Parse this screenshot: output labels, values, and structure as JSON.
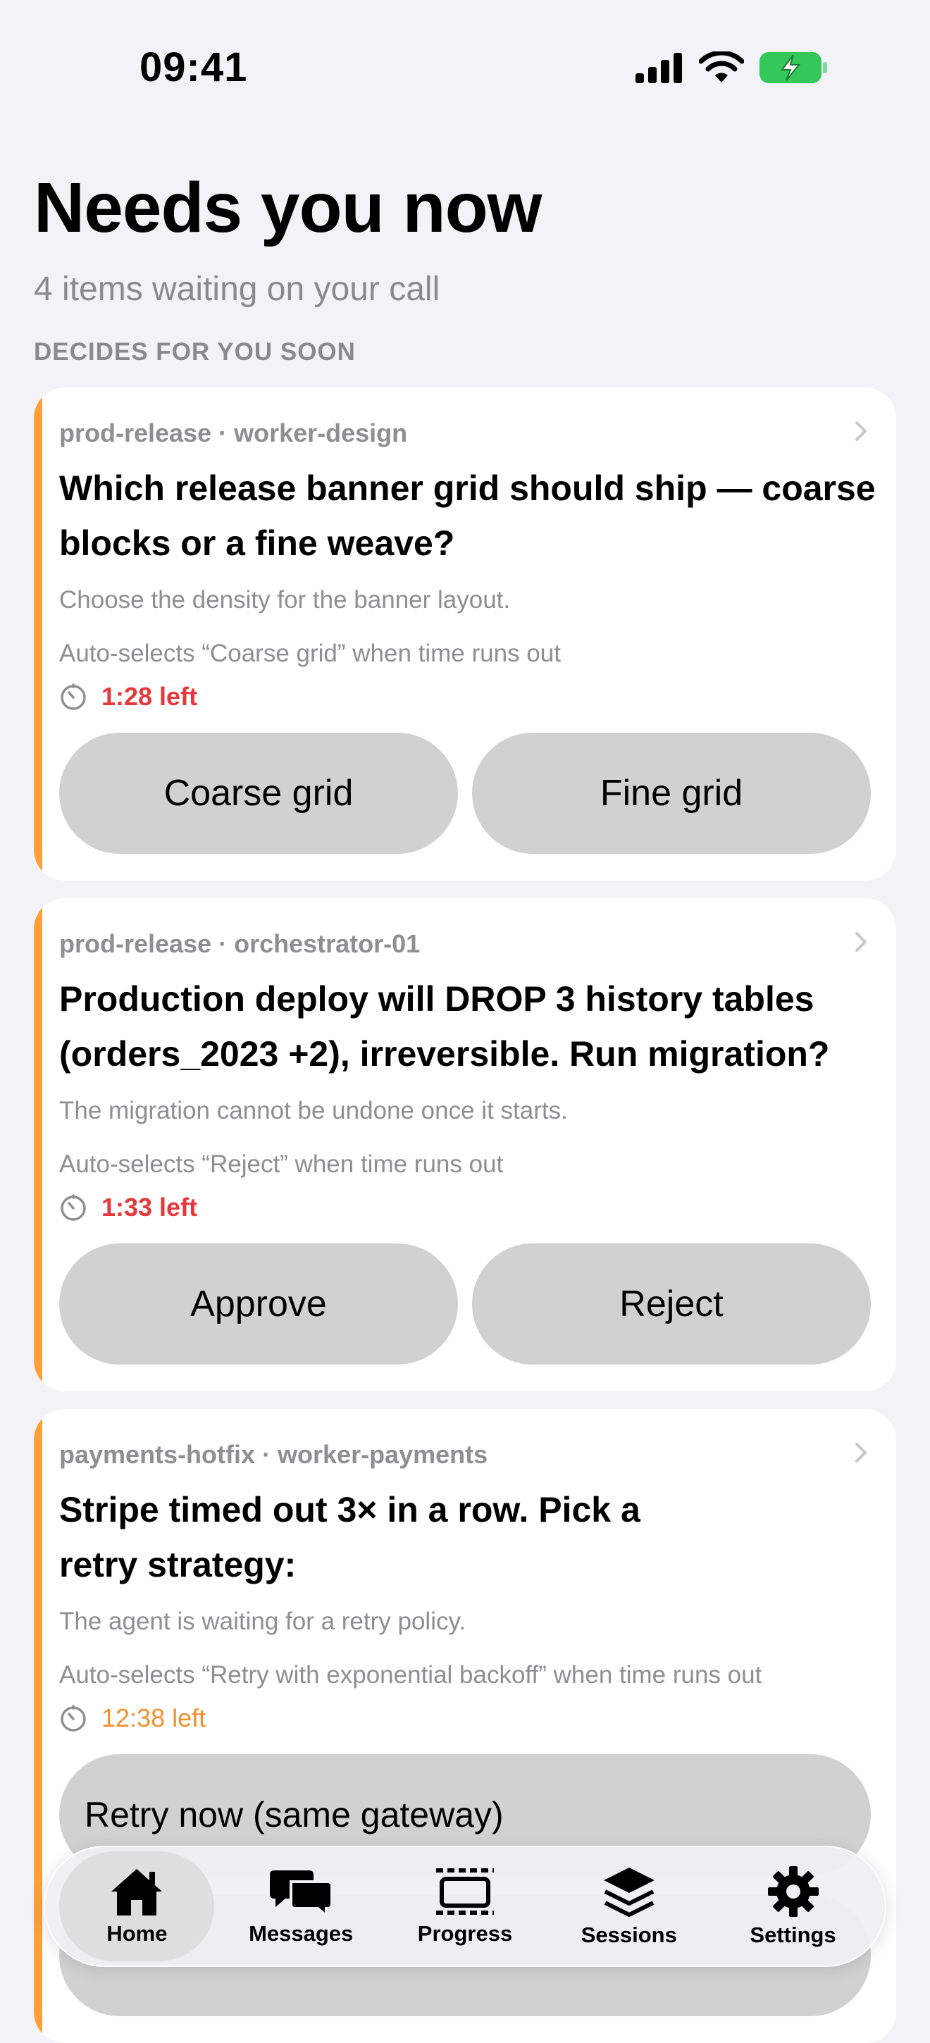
{
  "status_bar": {
    "time": "09:41",
    "icons": [
      "cellular-signal-icon",
      "wifi-icon",
      "battery-charging-icon"
    ],
    "battery_color": "#34C759"
  },
  "header": {
    "title": "Needs you now",
    "subtitle": "4 items waiting on your call"
  },
  "section_label": "DECIDES FOR YOU SOON",
  "accent_color": "#FF9F3A",
  "cards": [
    {
      "meta": "prod-release · worker-design",
      "title": "Which release banner grid should ship — coarse blocks or a fine weave?",
      "description": "Choose the density for the banner layout.",
      "auto_select": "Auto-selects “Coarse grid” when time runs out",
      "time_left": "1:28 left",
      "timer_color": "#E5383B",
      "options": [
        "Coarse grid",
        "Fine grid"
      ]
    },
    {
      "meta": "prod-release · orchestrator-01",
      "title": "Production deploy will DROP 3 history tables (orders_2023 +2), irreversible. Run migration?",
      "description": "The migration cannot be undone once it starts.",
      "auto_select": "Auto-selects “Reject” when time runs out",
      "time_left": "1:33 left",
      "timer_color": "#E5383B",
      "options": [
        "Approve",
        "Reject"
      ]
    },
    {
      "meta": "payments-hotfix · worker-payments",
      "title_line1": "Stripe timed out 3× in a row. Pick a",
      "title_line2": "retry strategy:",
      "description": "The agent is waiting for a retry policy.",
      "auto_select": "Auto-selects “Retry with exponential backoff” when time runs out",
      "time_left": "12:38 left",
      "timer_color": "#F0912E",
      "options": [
        "Retry now (same gateway)"
      ]
    }
  ],
  "tabbar": {
    "active": "Home",
    "tabs": [
      {
        "label": "Home",
        "icon": "home-icon"
      },
      {
        "label": "Messages",
        "icon": "messages-icon"
      },
      {
        "label": "Progress",
        "icon": "progress-icon"
      },
      {
        "label": "Sessions",
        "icon": "sessions-layers-icon"
      },
      {
        "label": "Settings",
        "icon": "gear-icon"
      }
    ]
  }
}
